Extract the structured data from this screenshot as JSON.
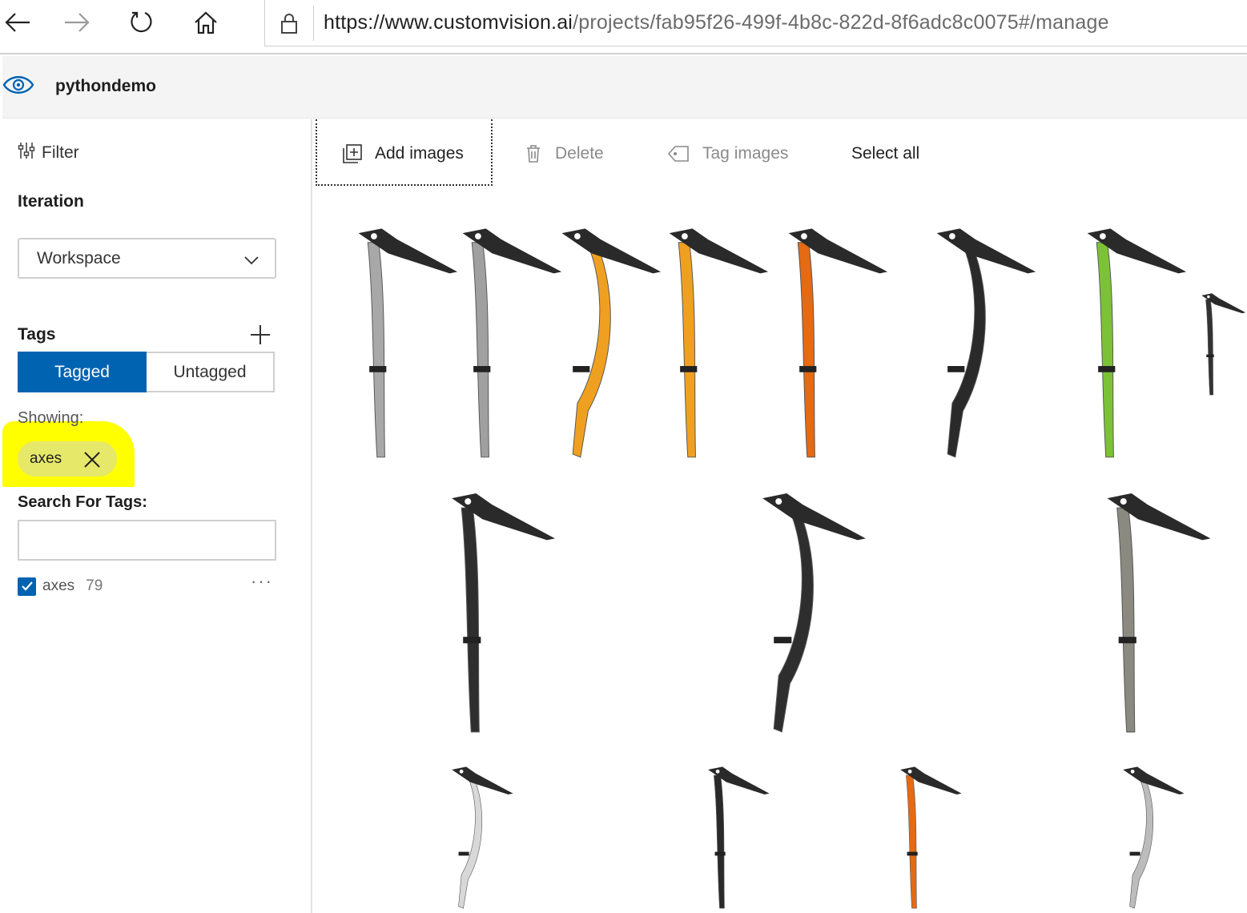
{
  "browser": {
    "url_host": "https://www.customvision.ai",
    "url_path": "/projects/fab95f26-499f-4b8c-822d-8f6adc8c0075#/manage"
  },
  "header": {
    "project_name": "pythondemo",
    "brand_color": "#0063b1"
  },
  "sidebar": {
    "filter_label": "Filter",
    "iteration_label": "Iteration",
    "iteration_value": "Workspace",
    "tags_label": "Tags",
    "tagged_label": "Tagged",
    "untagged_label": "Untagged",
    "showing_label": "Showing:",
    "active_filter_chip": "axes",
    "search_label": "Search For Tags:",
    "search_value": "",
    "tag_list": [
      {
        "name": "axes",
        "count": "79",
        "checked": true
      }
    ],
    "more_label": "···"
  },
  "toolbar": {
    "add_images": "Add images",
    "delete": "Delete",
    "tag_images": "Tag images",
    "select_all": "Select all"
  },
  "images": {
    "tag": "axes",
    "row1_colors": [
      "#a8a8a8",
      "#a0a0a0",
      "#f0a020",
      "#f0a020",
      "#e46a14",
      "#2a2a2a",
      "#7cc236",
      "#333333"
    ],
    "row2_colors": [
      "#2e2e2e",
      "#2e2e2e",
      "#8a8a80"
    ],
    "row3_colors": [
      "#d8d8d8",
      "#2a2a2a",
      "#e46a14",
      "#bcbcbc"
    ]
  }
}
